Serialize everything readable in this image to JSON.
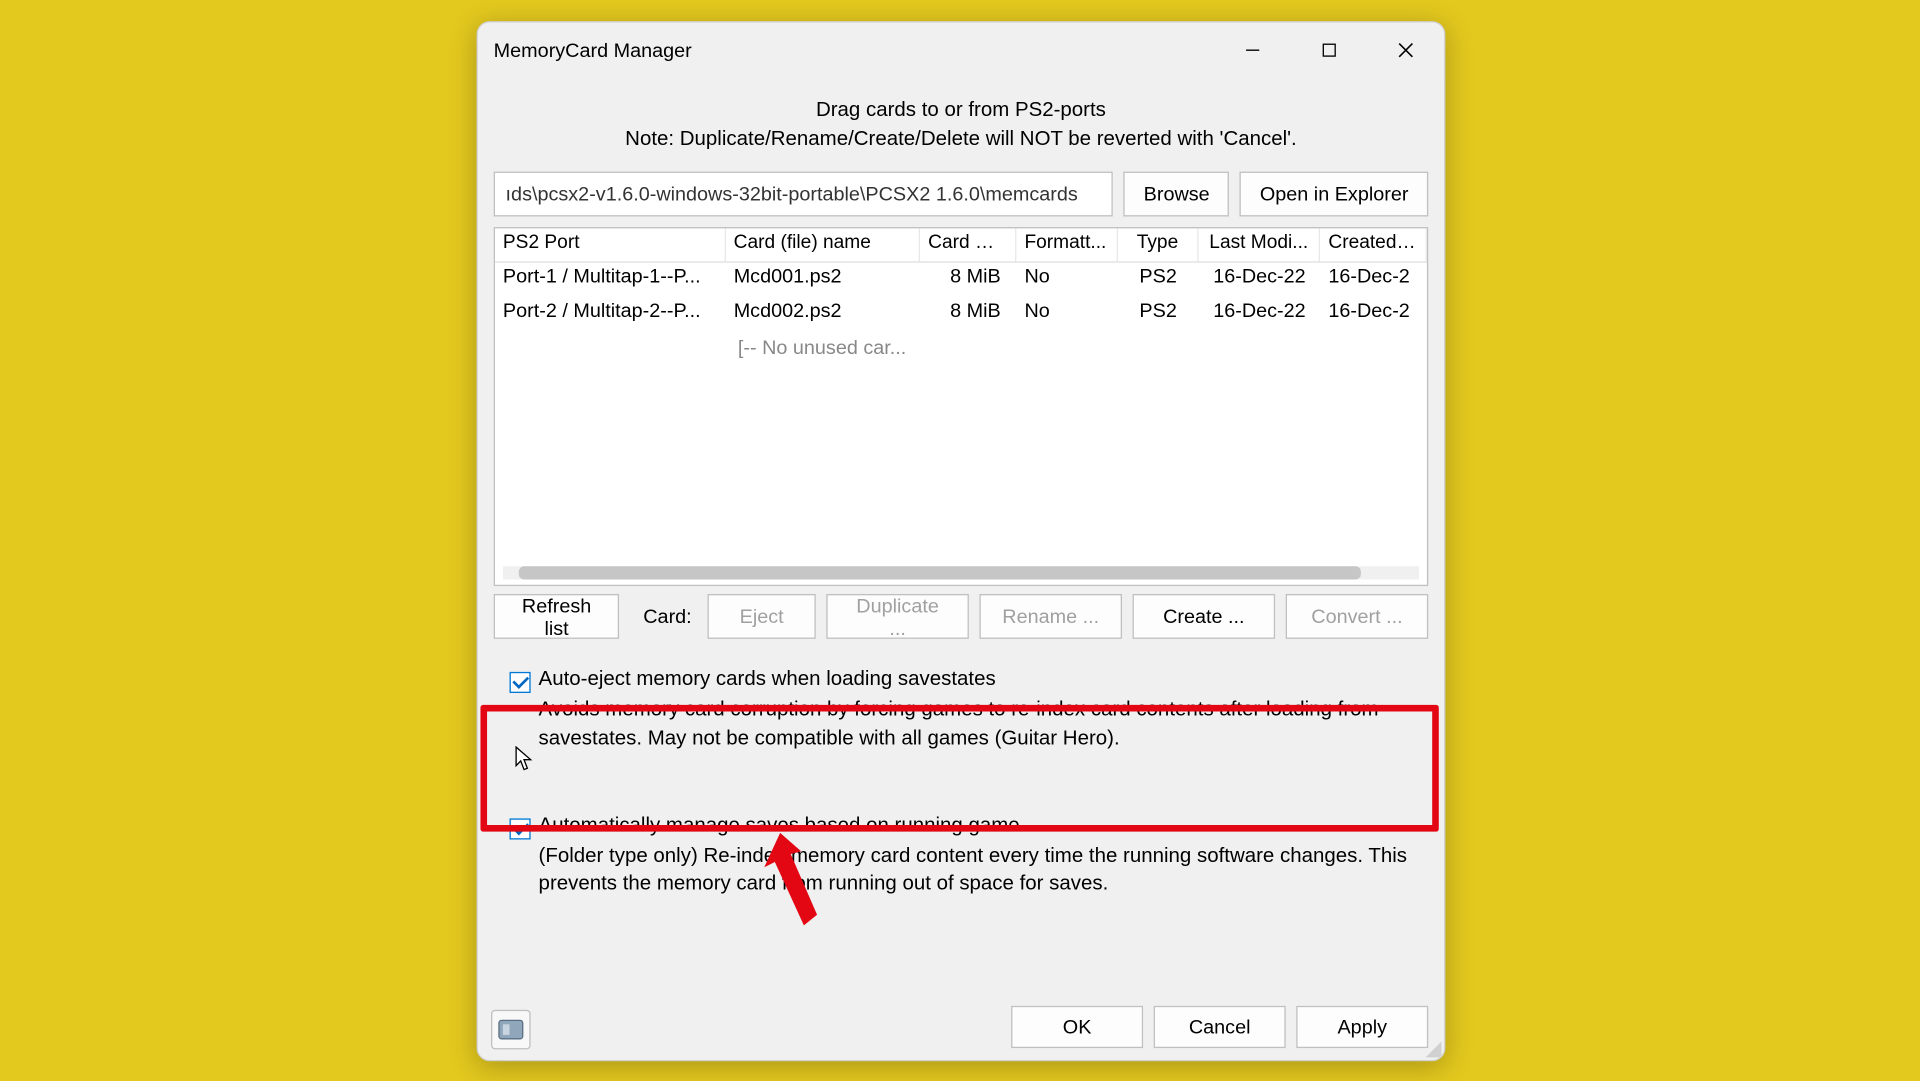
{
  "window": {
    "title": "MemoryCard Manager"
  },
  "instructions": {
    "line1": "Drag cards to or from PS2-ports",
    "line2": "Note: Duplicate/Rename/Create/Delete will NOT be reverted with 'Cancel'."
  },
  "path": {
    "value": "ıds\\pcsx2-v1.6.0-windows-32bit-portable\\PCSX2 1.6.0\\memcards",
    "browse": "Browse",
    "open_explorer": "Open in Explorer"
  },
  "table": {
    "headers": {
      "port": "PS2 Port",
      "card": "Card (file) name",
      "size": "Card s...",
      "formatted": "Formatt...",
      "type": "Type",
      "modified": "Last Modi...",
      "created": "Created on"
    },
    "rows": [
      {
        "port": "Port-1 / Multitap-1--P...",
        "card": "Mcd001.ps2",
        "size": "8 MiB",
        "formatted": "No",
        "type": "PS2",
        "modified": "16-Dec-22",
        "created": "16-Dec-2"
      },
      {
        "port": "Port-2 / Multitap-2--P...",
        "card": "Mcd002.ps2",
        "size": "8 MiB",
        "formatted": "No",
        "type": "PS2",
        "modified": "16-Dec-22",
        "created": "16-Dec-2"
      }
    ],
    "placeholder": "[-- No unused car..."
  },
  "toolbar": {
    "refresh": "Refresh list",
    "card_label": "Card:",
    "eject": "Eject",
    "duplicate": "Duplicate ...",
    "rename": "Rename ...",
    "create": "Create ...",
    "convert": "Convert ..."
  },
  "options": {
    "auto_eject": {
      "label": "Auto-eject memory cards when loading savestates",
      "desc": "Avoids memory card corruption by forcing games to re-index card contents after loading from savestates.  May not be compatible with all games (Guitar Hero).",
      "checked": true
    },
    "auto_manage": {
      "label": "Automatically manage saves based on running game",
      "desc": "(Folder type only) Re-index memory card content every time the running software changes. This prevents the memory card from running out of space for saves.",
      "checked": true
    }
  },
  "footer": {
    "ok": "OK",
    "cancel": "Cancel",
    "apply": "Apply"
  },
  "annotation": {
    "highlight_color": "#e30613"
  }
}
